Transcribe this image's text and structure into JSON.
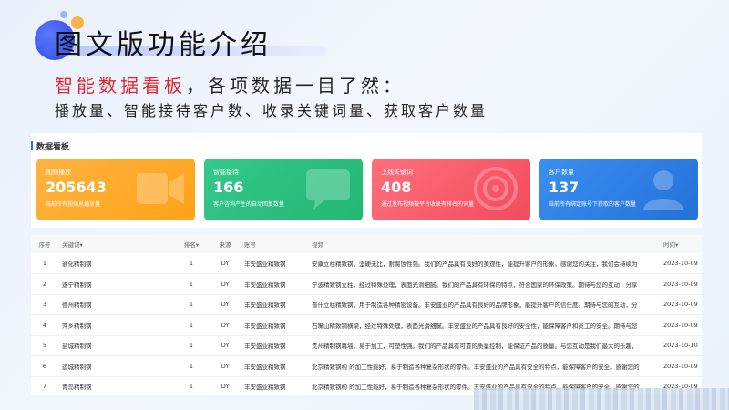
{
  "header": {
    "title": "图文版功能介绍",
    "subtitle_highlight": "智能数据看板",
    "subtitle_rest": "，各项数据一目了然：",
    "description": "播放量、智能接待客户数、收录关键词量、获取客户数量"
  },
  "dashboard": {
    "title": "数据看板",
    "cards": [
      {
        "label": "视频播放",
        "value": "205643",
        "note": "当前所有视频总播放量"
      },
      {
        "label": "智能接待",
        "value": "166",
        "note": "客户咨询产生的自动回复数量"
      },
      {
        "label": "上线关键词",
        "value": "408",
        "note": "通过发布视频被平台收录有排名的词量"
      },
      {
        "label": "客户数量",
        "value": "137",
        "note": "当前所有绑定账号下获取的客户数量"
      }
    ]
  },
  "table": {
    "headers": [
      "序号",
      "关键词▾",
      "排名▾",
      "来源",
      "账号",
      "视频",
      "时间▾"
    ],
    "rows": [
      [
        "1",
        "通化精制钢",
        "1",
        "DY",
        "丰安盛业精致钢",
        "安康立柱精致钢，坚硬无比，耐腐蚀性强。我们的产品具有良好的美观性，能提升客户的形象。感谢您的关注，我们会持续为",
        "2023-10-09"
      ],
      [
        "2",
        "遂宁精制钢",
        "1",
        "DY",
        "丰安盛业精致钢",
        "宁波精致钢立柱，经过特殊处理，表面光滑细腻。我们的产品具有环保的特点，符合国家的环保政策。期待与您的互动，分享",
        "2023-10-09"
      ],
      [
        "3",
        "德州精制钢",
        "1",
        "DY",
        "丰安盛业精致钢",
        "晋什立柱精致钢，用于制造各种精密设备。丰安盛业的产品具有良好的品牌形象，能提升客户的信任度。期待与您的互动，分",
        "2023-10-09"
      ],
      [
        "4",
        "萍乡精制钢",
        "1",
        "DY",
        "丰安盛业精致钢",
        "石嘴山精致钢横梁，经过特殊处理，表面光滑细腻。丰安盛业的产品具有良好的安全性，能保障客户和员工的安全。期待与您",
        "2023-10-09"
      ],
      [
        "5",
        "盐城精制钢",
        "1",
        "DY",
        "丰安盛业精致钢",
        "贵州精制钢幕墙，易于加工，可塑性强。我们的产品具有可靠的质量控制，能保证产品的质量。与您互动是我们最大的乐趣，",
        "2023-10-10"
      ],
      [
        "6",
        "运城精制钢",
        "1",
        "DY",
        "丰安盛业精致钢",
        "北京精致钢构 的加工性能好，易于制造各种复杂形状的零件。丰安盛业的产品具有安全的特点，能保障客户的安全。感谢您的",
        "2023-10-09"
      ],
      [
        "7",
        "青岛精制钢",
        "1",
        "DY",
        "丰安盛业精致钢",
        "北京精致钢构 的加工性能好，易于制造各种复杂形状的零件。丰安盛业的产品具有安全的特点，能保障客户的安全。感谢您的",
        "2023-10-09"
      ]
    ]
  }
}
